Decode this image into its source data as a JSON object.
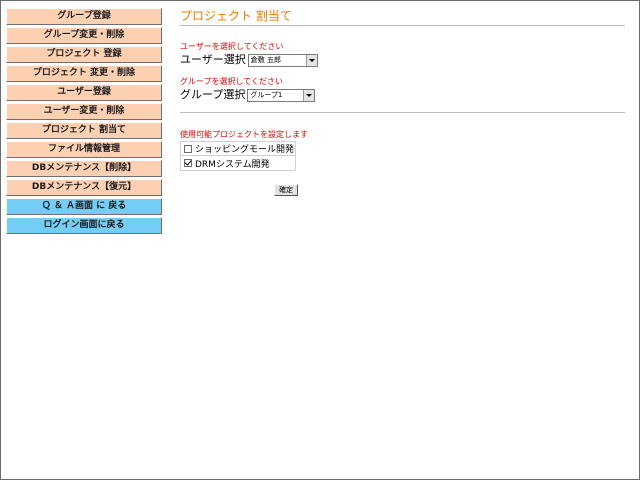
{
  "sidebar": {
    "items": [
      {
        "label": "グループ登録",
        "color": "#fdd0b2"
      },
      {
        "label": "グループ変更・削除",
        "color": "#fdd0b2"
      },
      {
        "label": "プロジェクト 登録",
        "color": "#fdd0b2"
      },
      {
        "label": "プロジェクト 変更・削除",
        "color": "#fdd0b2"
      },
      {
        "label": "ユーザー登録",
        "color": "#fdd0b2"
      },
      {
        "label": "ユーザー変更・削除",
        "color": "#fdd0b2"
      },
      {
        "label": "プロジェクト 割当て",
        "color": "#fdd0b2"
      },
      {
        "label": "ファイル情報管理",
        "color": "#fdd0b2"
      },
      {
        "label": "DBメンテナンス【削除】",
        "color": "#fdd0b2"
      },
      {
        "label": "DBメンテナンス【復元】",
        "color": "#fdd0b2"
      },
      {
        "label": "Ｑ ＆ Ａ画面 に 戻る",
        "color": "#74cdf5"
      },
      {
        "label": "ログイン画面に戻る",
        "color": "#74cdf5"
      }
    ]
  },
  "main": {
    "title": "プロジェクト 割当て",
    "title_color": "#f07800",
    "user_section": {
      "instruction": "ユーザーを選択してください",
      "label": "ユーザー選択",
      "selected": "倉敷 五郎"
    },
    "group_section": {
      "instruction": "グループを選択してください",
      "label": "グループ選択",
      "selected": "グループ1"
    },
    "project_section": {
      "instruction": "使用可能プロジェクトを設定します",
      "projects": [
        {
          "label": "ショッピングモール開発",
          "checked": false
        },
        {
          "label": "DRMシステム開発",
          "checked": true
        }
      ],
      "confirm_label": "確定"
    },
    "instruction_color": "#e00000"
  }
}
